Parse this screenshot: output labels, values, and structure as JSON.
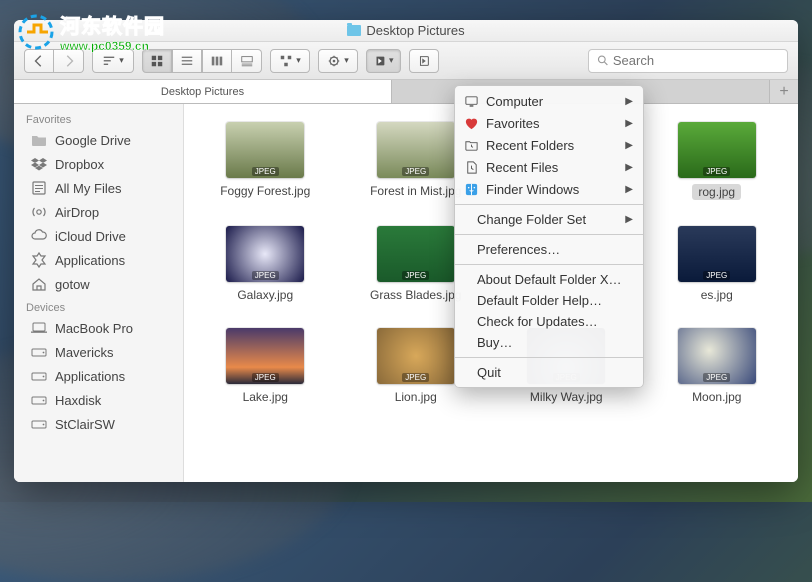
{
  "watermark": {
    "title": "河东软件园",
    "url": "www.pc0359.cn"
  },
  "window": {
    "title": "Desktop Pictures"
  },
  "toolbar": {
    "search_placeholder": "Search"
  },
  "tabs": [
    "Desktop Pictures"
  ],
  "sidebar": {
    "sections": [
      {
        "label": "Favorites",
        "items": [
          "Google Drive",
          "Dropbox",
          "All My Files",
          "AirDrop",
          "iCloud Drive",
          "Applications",
          "gotow"
        ]
      },
      {
        "label": "Devices",
        "items": [
          "MacBook Pro",
          "Mavericks",
          "Applications",
          "Haxdisk",
          "StClairSW"
        ]
      }
    ]
  },
  "files": [
    {
      "name": "Foggy Forest.jpg"
    },
    {
      "name": "Forest in Mist.jpg"
    },
    {
      "name": ""
    },
    {
      "name": "rog.jpg",
      "selected": true
    },
    {
      "name": "Galaxy.jpg"
    },
    {
      "name": "Grass Blades.jpg"
    },
    {
      "name": ""
    },
    {
      "name": "es.jpg"
    },
    {
      "name": "Lake.jpg"
    },
    {
      "name": "Lion.jpg"
    },
    {
      "name": "Milky Way.jpg"
    },
    {
      "name": "Moon.jpg"
    }
  ],
  "menu": {
    "items": [
      {
        "label": "Computer",
        "submenu": true
      },
      {
        "label": "Favorites",
        "submenu": true
      },
      {
        "label": "Recent Folders",
        "submenu": true
      },
      {
        "label": "Recent Files",
        "submenu": true
      },
      {
        "label": "Finder Windows",
        "submenu": true
      },
      {
        "label": "Change Folder Set",
        "submenu": true
      },
      {
        "label": "Preferences…"
      },
      {
        "label": "About Default Folder X…"
      },
      {
        "label": "Default Folder Help…"
      },
      {
        "label": "Check for Updates…"
      },
      {
        "label": "Buy…"
      },
      {
        "label": "Quit"
      }
    ]
  }
}
